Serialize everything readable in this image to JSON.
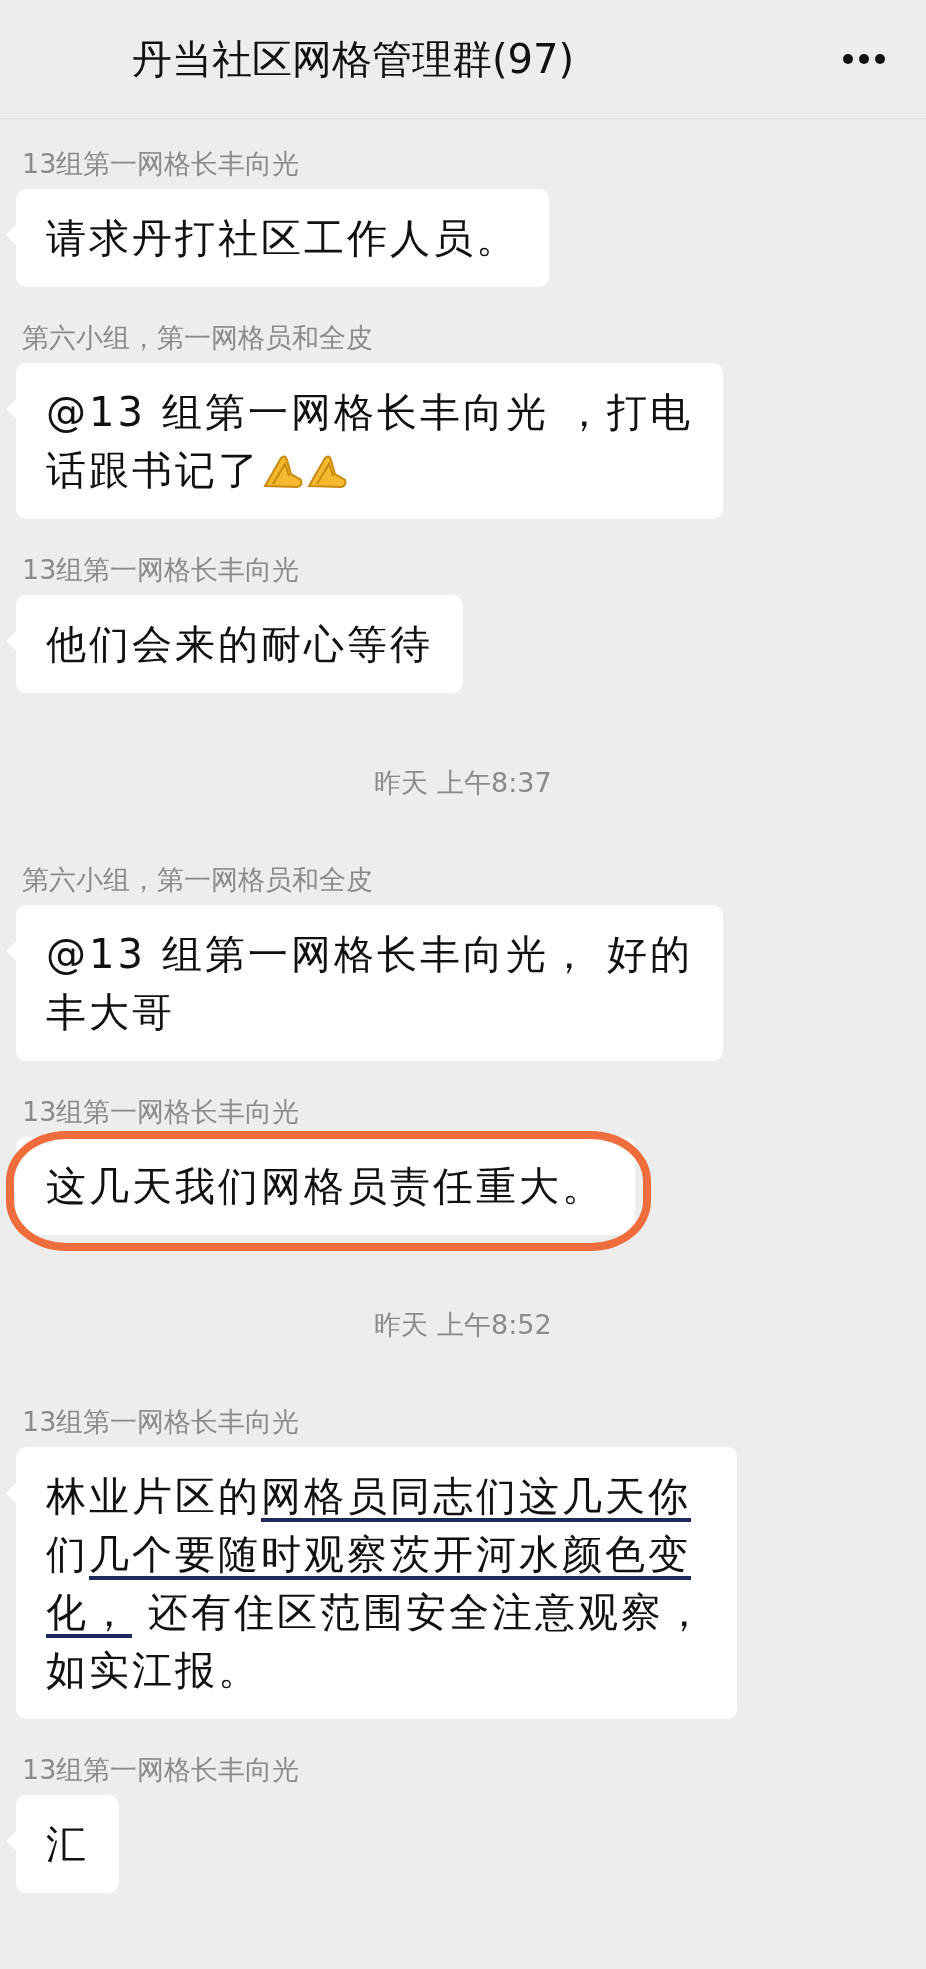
{
  "header": {
    "title": "丹当社区网格管理群(97)"
  },
  "messages": [
    {
      "kind": "message",
      "sender": "13组第一网格长丰向光",
      "lines": [
        [
          {
            "text": "请求丹打社区工作人员。"
          }
        ]
      ]
    },
    {
      "kind": "message",
      "sender": "第六小组，第一网格员和全皮",
      "lines": [
        [
          {
            "text": "@13 组第一网格长丰向光 ，打电"
          }
        ],
        [
          {
            "text": "话跟书记了"
          }
        ]
      ],
      "trailing_icons": [
        {
          "kind": "folded-hands"
        },
        {
          "kind": "folded-hands"
        }
      ]
    },
    {
      "kind": "message",
      "sender": "13组第一网格长丰向光",
      "lines": [
        [
          {
            "text": "他们会来的耐心等待"
          }
        ]
      ]
    },
    {
      "kind": "time",
      "text": "昨天 上午8:37"
    },
    {
      "kind": "message",
      "sender": "第六小组，第一网格员和全皮",
      "lines": [
        [
          {
            "text": "@13 组第一网格长丰向光， 好的"
          }
        ],
        [
          {
            "text": "丰大哥"
          }
        ]
      ]
    },
    {
      "kind": "message",
      "sender": "13组第一网格长丰向光",
      "lines": [
        [
          {
            "text": "这几天我们网格员责任重大。"
          }
        ]
      ],
      "highlighted": true
    },
    {
      "kind": "time",
      "text": "昨天 上午8:52"
    },
    {
      "kind": "message",
      "sender": "13组第一网格长丰向光",
      "lines": [
        [
          {
            "text": "林业片区的",
            "underlined": false
          },
          {
            "text": "网格员同志们这几天你",
            "underlined": true
          }
        ],
        [
          {
            "text": "们",
            "underlined": false
          },
          {
            "text": "几个要随时观察茨开河水颜色变",
            "underlined": true
          }
        ],
        [
          {
            "text": "化，",
            "underlined": true
          },
          {
            "text": " 还有住区范围安全注意观察，",
            "underlined": false
          }
        ],
        [
          {
            "text": "如实江报。",
            "underlined": false
          }
        ]
      ]
    },
    {
      "kind": "message",
      "sender": "13组第一网格长丰向光",
      "lines": [
        [
          {
            "text": "汇"
          }
        ]
      ]
    }
  ]
}
